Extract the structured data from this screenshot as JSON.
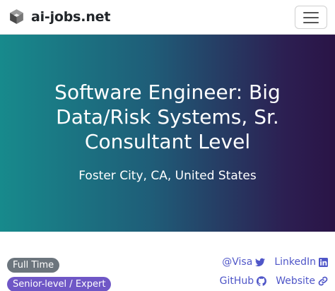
{
  "navbar": {
    "brand": "ai-jobs.net",
    "logo_icon": "cube-logo-icon",
    "menu_icon": "hamburger-menu-icon"
  },
  "hero": {
    "title": "Software Engineer: Big Data/Risk Systems, Sr. Consultant Level",
    "location": "Foster City, CA, United States",
    "gradient_colors": [
      "#178a8c",
      "#2a1446"
    ]
  },
  "badges": {
    "employment_type": "Full Time",
    "level": "Senior-level / Expert"
  },
  "links": {
    "twitter": "@Visa",
    "linkedin": "LinkedIn",
    "github": "GitHub",
    "website": "Website"
  },
  "colors": {
    "link": "#4f56c8",
    "badge_type": "#6c757d",
    "badge_level": "#6f57c6"
  }
}
